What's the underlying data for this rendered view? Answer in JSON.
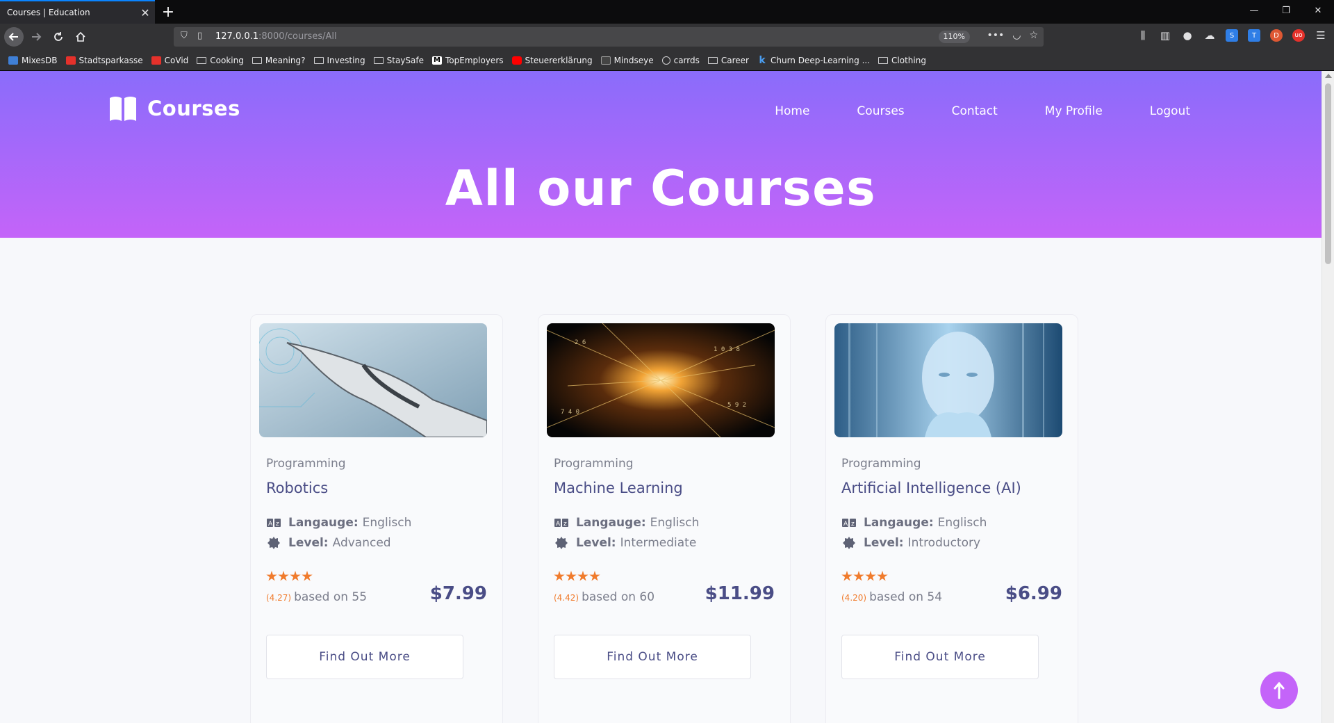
{
  "browser": {
    "tab_title": "Courses | Education",
    "tab_close": "✕",
    "new_tab": "+",
    "url_host": "127.0.0.1",
    "url_path": ":8000/courses/All",
    "zoom": "110%",
    "bookmarks": [
      {
        "label": "MixesDB",
        "icon": "mixesdb-icon"
      },
      {
        "label": "Stadtsparkasse",
        "icon": "sparkasse-icon"
      },
      {
        "label": "CoVid",
        "icon": "covid-icon"
      },
      {
        "label": "Cooking",
        "icon": "folder-icon"
      },
      {
        "label": "Meaning?",
        "icon": "folder-icon"
      },
      {
        "label": "Investing",
        "icon": "folder-icon"
      },
      {
        "label": "StaySafe",
        "icon": "folder-icon"
      },
      {
        "label": "TopEmployers",
        "icon": "m-icon"
      },
      {
        "label": "Steuererklärung",
        "icon": "youtube-icon"
      },
      {
        "label": "Mindseye",
        "icon": "mindseye-icon"
      },
      {
        "label": "carrds",
        "icon": "globe-icon"
      },
      {
        "label": "Career",
        "icon": "folder-icon"
      },
      {
        "label": "Churn Deep-Learning ...",
        "icon": "k-icon"
      },
      {
        "label": "Clothing",
        "icon": "folder-icon"
      }
    ]
  },
  "site": {
    "logo_text": "Courses",
    "menu": [
      "Home",
      "Courses",
      "Contact",
      "My Profile",
      "Logout"
    ],
    "hero_title": "All our Courses"
  },
  "courses": [
    {
      "category": "Programming",
      "title": "Robotics",
      "language_label": "Langauge:",
      "language": "Englisch",
      "level_label": "Level:",
      "level": "Advanced",
      "stars": 4,
      "rating": "(4.27)",
      "based_on": "based on 55",
      "price": "$7.99",
      "button": "Find Out More"
    },
    {
      "category": "Programming",
      "title": "Machine Learning",
      "language_label": "Langauge:",
      "language": "Englisch",
      "level_label": "Level:",
      "level": "Intermediate",
      "stars": 4,
      "rating": "(4.42)",
      "based_on": "based on 60",
      "price": "$11.99",
      "button": "Find Out More"
    },
    {
      "category": "Programming",
      "title": "Artificial Intelligence (AI)",
      "language_label": "Langauge:",
      "language": "Englisch",
      "level_label": "Level:",
      "level": "Introductory",
      "stars": 4,
      "rating": "(4.20)",
      "based_on": "based on 54",
      "price": "$6.99",
      "button": "Find Out More"
    }
  ],
  "colors": {
    "hero_top": "#8a6cfa",
    "hero_bottom": "#c464f9",
    "accent_orange": "#f07b2c",
    "title_navy": "#4a4d86"
  }
}
